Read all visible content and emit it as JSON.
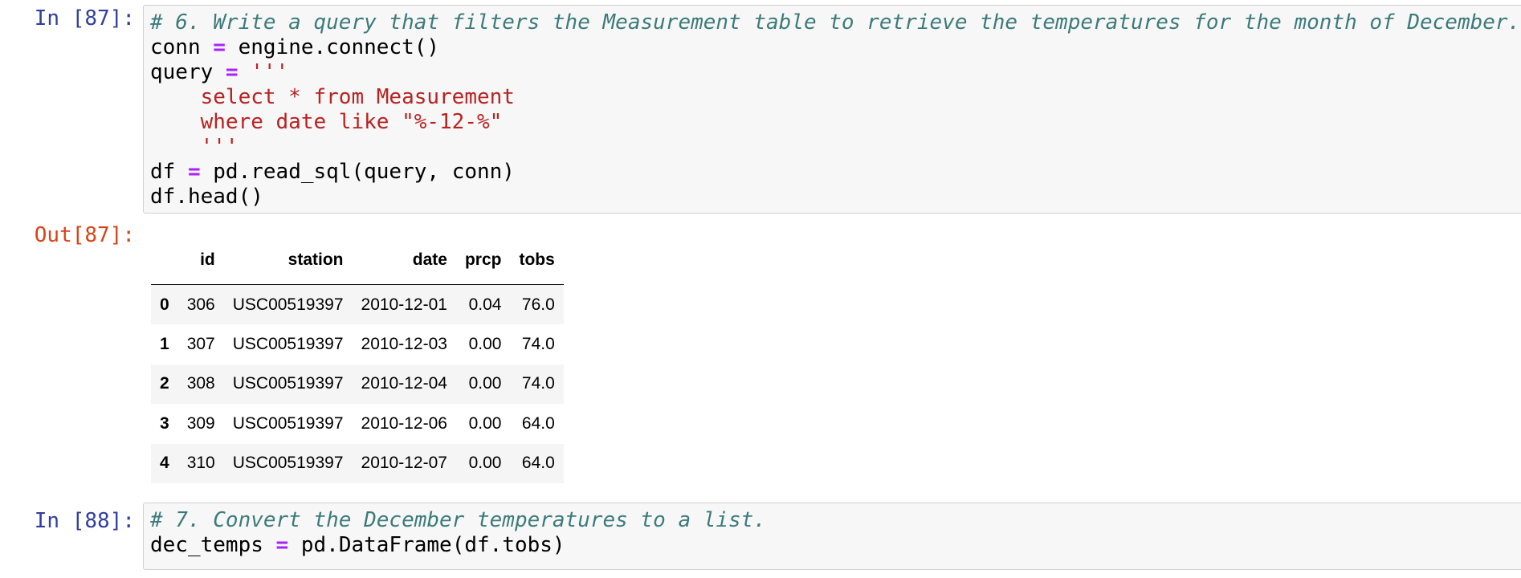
{
  "cell87": {
    "in_prompt": "In [87]:",
    "out_prompt": "Out[87]:",
    "code": {
      "comment": "# 6. Write a query that filters the Measurement table to retrieve the temperatures for the month of December.",
      "conn_var": "conn",
      "conn_rhs": "engine.connect()",
      "query_var": "query",
      "triple_quote": "'''",
      "sql_line1": "    select * from Measurement",
      "sql_line2": "    where date like \"%-12-%\"",
      "sql_close": "    '''",
      "df_var": "df",
      "df_rhs": "pd.read_sql(query, conn)",
      "head_call": "df.head()",
      "assign_op": " = "
    },
    "table": {
      "columns": [
        "id",
        "station",
        "date",
        "prcp",
        "tobs"
      ],
      "rows": [
        {
          "index": "0",
          "id": "306",
          "station": "USC00519397",
          "date": "2010-12-01",
          "prcp": "0.04",
          "tobs": "76.0"
        },
        {
          "index": "1",
          "id": "307",
          "station": "USC00519397",
          "date": "2010-12-03",
          "prcp": "0.00",
          "tobs": "74.0"
        },
        {
          "index": "2",
          "id": "308",
          "station": "USC00519397",
          "date": "2010-12-04",
          "prcp": "0.00",
          "tobs": "74.0"
        },
        {
          "index": "3",
          "id": "309",
          "station": "USC00519397",
          "date": "2010-12-06",
          "prcp": "0.00",
          "tobs": "64.0"
        },
        {
          "index": "4",
          "id": "310",
          "station": "USC00519397",
          "date": "2010-12-07",
          "prcp": "0.00",
          "tobs": "64.0"
        }
      ]
    }
  },
  "cell88": {
    "in_prompt": "In [88]:",
    "code": {
      "comment": "# 7. Convert the December temperatures to a list.",
      "var": "dec_temps",
      "assign_op": " = ",
      "rhs": "pd.DataFrame(df.tobs)"
    }
  },
  "colors": {
    "in_prompt": "#303f9f",
    "out_prompt": "#d84315",
    "comment": "#3d7b7b",
    "operator": "#aa22ff",
    "string": "#ba2121",
    "cell_bg": "#f7f7f7",
    "cell_border": "#cfcfcf"
  }
}
